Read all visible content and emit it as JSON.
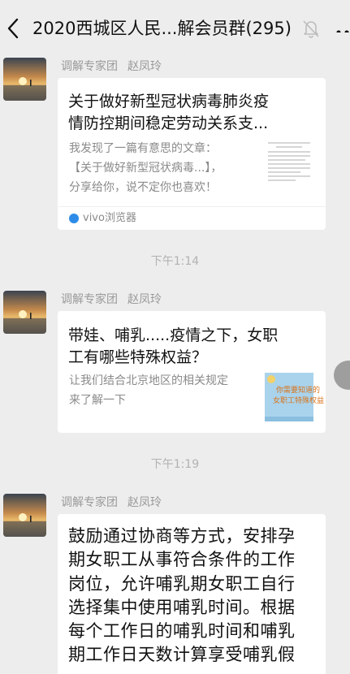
{
  "header": {
    "title": "2020西城区人民...解会员群(295)",
    "back_icon": "chevron-left-icon",
    "mute_icon": "bell-off-icon",
    "more_icon": "more-dots-icon"
  },
  "messages": [
    {
      "sender_group": "调解专家团",
      "sender_name": "赵凤玲",
      "card_title_1": "关于做好新型冠状病毒肺炎疫",
      "card_title_2": "情防控期间稳定劳动关系支...",
      "card_desc_1": "我发现了一篇有意思的文章：",
      "card_desc_2": "【关于做好新型冠状病毒...】，",
      "card_desc_3": "分享给你，说不定你也喜欢！",
      "source_label": "vivo浏览器"
    },
    {
      "sender_group": "调解专家团",
      "sender_name": "赵凤玲",
      "card_title_1": "带娃、哺乳.....疫情之下，女职",
      "card_title_2": "工有哪些特殊权益？",
      "card_desc_1": "让我们结合北京地区的相关规定",
      "card_desc_2": "来了解一下",
      "thumb_text_1": "你需要知道的",
      "thumb_text_2": "女职工特殊权益"
    },
    {
      "sender_group": "调解专家团",
      "sender_name": "赵凤玲",
      "lines": [
        "鼓励通过协商等方式，安排孕",
        "期女职工从事符合条件的工作",
        "岗位，允许哺乳期女职工自行",
        "选择集中使用哺乳时间。根据",
        "每个工作日的哺乳时间和哺乳",
        "期工作日天数计算享受哺乳假"
      ]
    }
  ],
  "timestamps": [
    "下午1:14",
    "下午1:19"
  ],
  "colors": {
    "background": "#ededed",
    "bubble": "#ffffff",
    "meta_text": "#9a9a9a",
    "source_icon": "#2e8ce8"
  }
}
